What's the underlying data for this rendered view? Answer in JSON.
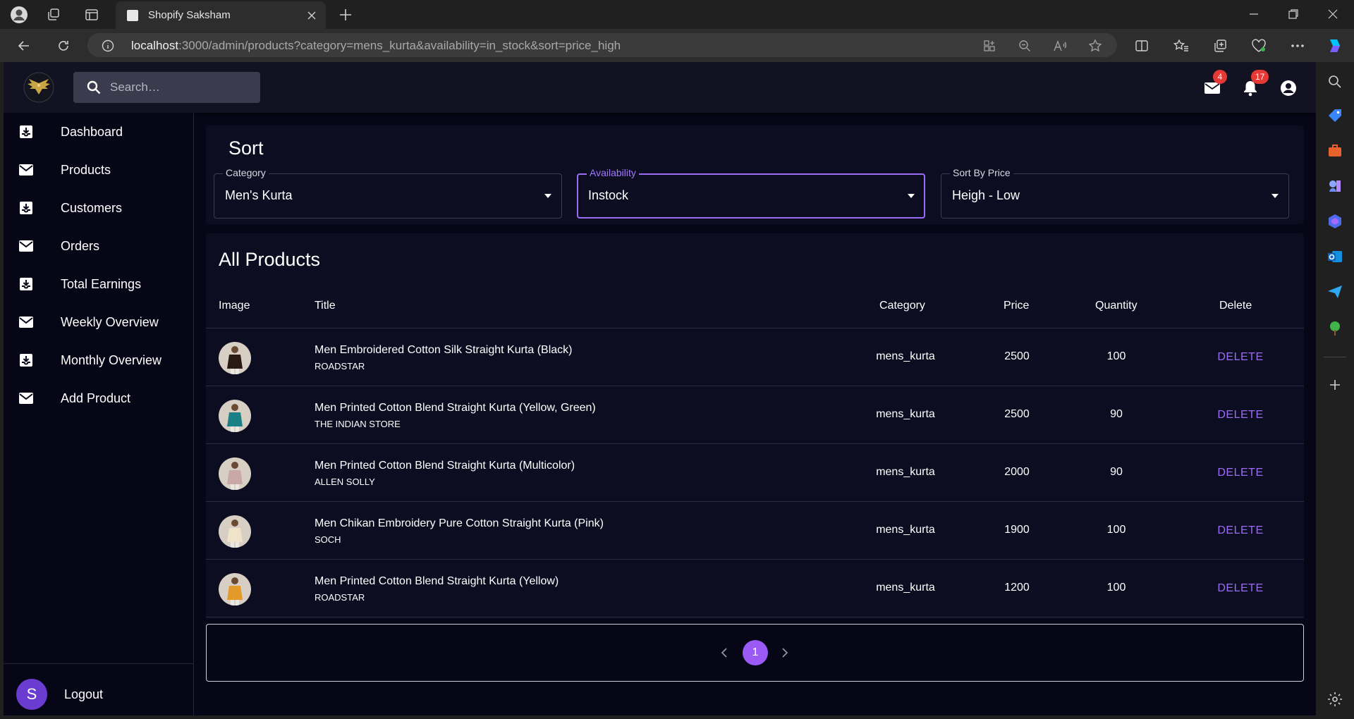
{
  "browser": {
    "tab_title": "Shopify Saksham",
    "url_host": "localhost",
    "url_rest": ":3000/admin/products?category=mens_kurta&availability=in_stock&sort=price_high"
  },
  "header": {
    "search_placeholder": "Search…",
    "mail_count": "4",
    "notification_count": "17"
  },
  "sidebar": {
    "items": [
      {
        "label": "Dashboard",
        "icon": "inbox-icon"
      },
      {
        "label": "Products",
        "icon": "mail-icon"
      },
      {
        "label": "Customers",
        "icon": "inbox-icon"
      },
      {
        "label": "Orders",
        "icon": "mail-icon"
      },
      {
        "label": "Total Earnings",
        "icon": "inbox-icon"
      },
      {
        "label": "Weekly Overview",
        "icon": "mail-icon"
      },
      {
        "label": "Monthly Overview",
        "icon": "inbox-icon"
      },
      {
        "label": "Add Product",
        "icon": "mail-icon"
      }
    ],
    "logout_avatar": "S",
    "logout_label": "Logout"
  },
  "sort": {
    "title": "Sort",
    "category_label": "Category",
    "category_value": "Men's Kurta",
    "availability_label": "Availability",
    "availability_value": "Instock",
    "price_label": "Sort By Price",
    "price_value": "Heigh - Low"
  },
  "products": {
    "title": "All Products",
    "columns": [
      "Image",
      "Title",
      "Category",
      "Price",
      "Quantity",
      "Delete"
    ],
    "delete_label": "DELETE",
    "rows": [
      {
        "title": "Men Embroidered Cotton Silk Straight Kurta (Black)",
        "brand": "ROADSTAR",
        "category": "mens_kurta",
        "price": "2500",
        "quantity": "100",
        "thumb_color": "#2a1a14"
      },
      {
        "title": "Men Printed Cotton Blend Straight Kurta (Yellow, Green)",
        "brand": "THE INDIAN STORE",
        "category": "mens_kurta",
        "price": "2500",
        "quantity": "90",
        "thumb_color": "#1b7f86"
      },
      {
        "title": "Men Printed Cotton Blend Straight Kurta (Multicolor)",
        "brand": "ALLEN SOLLY",
        "category": "mens_kurta",
        "price": "2000",
        "quantity": "90",
        "thumb_color": "#c9a9a8"
      },
      {
        "title": "Men Chikan Embroidery Pure Cotton Straight Kurta (Pink)",
        "brand": "SOCH",
        "category": "mens_kurta",
        "price": "1900",
        "quantity": "100",
        "thumb_color": "#efe3c9"
      },
      {
        "title": "Men Printed Cotton Blend Straight Kurta (Yellow)",
        "brand": "ROADSTAR",
        "category": "mens_kurta",
        "price": "1200",
        "quantity": "100",
        "thumb_color": "#e39a2a"
      }
    ]
  },
  "pagination": {
    "current_page": "1"
  },
  "colors": {
    "accent": "#9b6cf5",
    "background": "#060617",
    "card": "#0d0d22",
    "badge": "#e53935"
  }
}
